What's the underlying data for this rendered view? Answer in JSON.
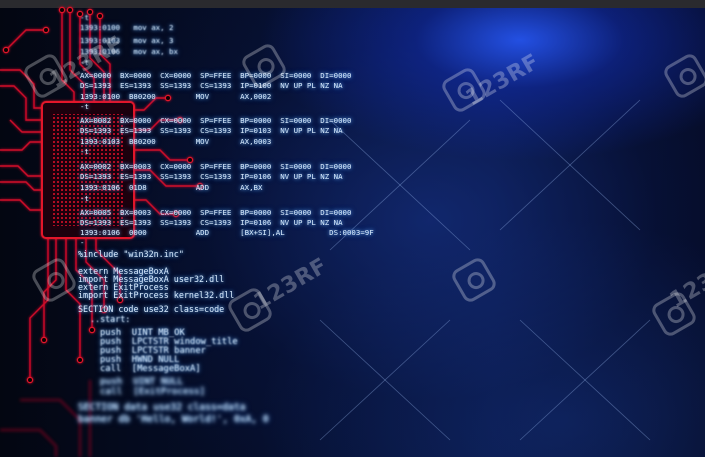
{
  "code_lines": [
    "-t",
    "1393:0100   mov ax, 2",
    "1393:0103   mov ax, 3",
    "1393:0106   mov ax, bx",
    "-t",
    "AX=0000  BX=0000  CX=0000  SP=FFEE  BP=0000  SI=0000  DI=0000",
    "DS=1393  ES=1393  SS=1393  CS=1393  IP=0100  NV UP PL NZ NA",
    "1393:0100  B80200         MOV       AX,0002",
    "-t",
    "AX=0002  BX=0000  CX=0000  SP=FFEE  BP=0000  SI=0000  DI=0000",
    "DS=1393  ES=1393  SS=1393  CS=1393  IP=0103  NV UP PL NZ NA",
    "1393:0103  B80200         MOV       AX,0003",
    "-t",
    "AX=0002  BX=0003  CX=0000  SP=FFEE  BP=0000  SI=0000  DI=0000",
    "DS=1393  ES=1393  SS=1393  CS=1393  IP=0106  NV UP PL NZ NA",
    "1393:0106  01D8           ADD       AX,BX",
    "-t",
    "AX=0005  BX=0003  CX=0000  SP=FFEE  BP=0000  SI=0000  DI=0000",
    "DS=1393  ES=1393  SS=1393  CS=1393  IP=0106  NV UP PL NZ NA",
    "1393:0106  0000           ADD       [BX+SI],AL          DS:0003=9F",
    "-",
    "%include \"win32n.inc\"",
    "extern MessageBoxA",
    "import MessageBoxA user32.dll",
    "extern ExitProcess",
    "import ExitProcess kernel32.dll",
    "SECTION code use32 class=code",
    "..start:",
    "push  UINT MB_OK",
    "push  LPCTSTR window_title",
    "push  LPCTSTR banner",
    "push  HWND NULL",
    "call  [MessageBoxA]",
    "push  UINT NULL",
    "call  [ExitProcess]",
    "SECTION data use32 class=data",
    "banner db 'Hello, World!', 0xA, 0"
  ],
  "watermark": {
    "text": "123RF"
  },
  "colors": {
    "circuit": "#e3142a",
    "code_glow": "#8fc4ff",
    "light_flare": "#2a5aff"
  }
}
